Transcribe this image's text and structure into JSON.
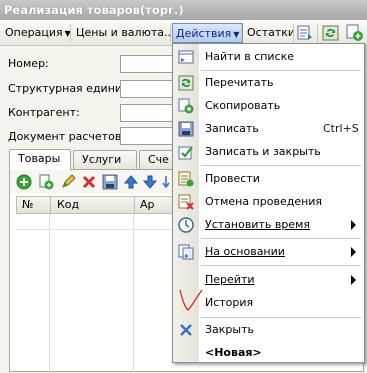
{
  "window": {
    "title": "Реализация товаров(торг.)"
  },
  "toolbar": {
    "operation": "Операция",
    "prices": "Цены и валюта...",
    "actions": "Действия",
    "balances": "Остатки"
  },
  "form": {
    "number_label": "Номер:",
    "unit_label": "Структурная единица:",
    "counterparty_label": "Контрагент:",
    "settlement_doc_label": "Документ расчетов:"
  },
  "tabs": {
    "goods": "Товары",
    "services": "Услуги",
    "third": "Сче"
  },
  "grid": {
    "col_num": "№",
    "col_code": "Код",
    "col_art": "Ар"
  },
  "menu": {
    "find_in_list": "Найти в списке",
    "reread": "Перечитать",
    "copy": "Скопировать",
    "save": "Записать",
    "save_shortcut": "Ctrl+S",
    "save_and_close": "Записать и закрыть",
    "post": "Провести",
    "cancel_posting": "Отмена проведения",
    "set_time": "Установить время",
    "based_on": "На основании",
    "go_to": "Перейти",
    "history": "История",
    "close": "Закрыть",
    "new": "<Новая>"
  },
  "colors": {
    "accent": "#0a2a7a",
    "menu_highlight": "#b7cdef",
    "stroke": "#d11a1a"
  }
}
